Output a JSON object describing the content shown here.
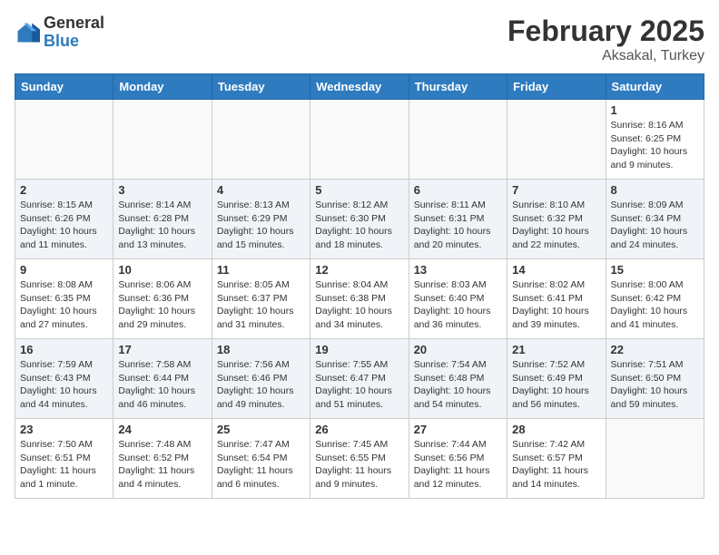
{
  "header": {
    "logo_general": "General",
    "logo_blue": "Blue",
    "month_year": "February 2025",
    "location": "Aksakal, Turkey"
  },
  "days_of_week": [
    "Sunday",
    "Monday",
    "Tuesday",
    "Wednesday",
    "Thursday",
    "Friday",
    "Saturday"
  ],
  "weeks": [
    [
      {
        "day": "",
        "detail": ""
      },
      {
        "day": "",
        "detail": ""
      },
      {
        "day": "",
        "detail": ""
      },
      {
        "day": "",
        "detail": ""
      },
      {
        "day": "",
        "detail": ""
      },
      {
        "day": "",
        "detail": ""
      },
      {
        "day": "1",
        "detail": "Sunrise: 8:16 AM\nSunset: 6:25 PM\nDaylight: 10 hours\nand 9 minutes."
      }
    ],
    [
      {
        "day": "2",
        "detail": "Sunrise: 8:15 AM\nSunset: 6:26 PM\nDaylight: 10 hours\nand 11 minutes."
      },
      {
        "day": "3",
        "detail": "Sunrise: 8:14 AM\nSunset: 6:28 PM\nDaylight: 10 hours\nand 13 minutes."
      },
      {
        "day": "4",
        "detail": "Sunrise: 8:13 AM\nSunset: 6:29 PM\nDaylight: 10 hours\nand 15 minutes."
      },
      {
        "day": "5",
        "detail": "Sunrise: 8:12 AM\nSunset: 6:30 PM\nDaylight: 10 hours\nand 18 minutes."
      },
      {
        "day": "6",
        "detail": "Sunrise: 8:11 AM\nSunset: 6:31 PM\nDaylight: 10 hours\nand 20 minutes."
      },
      {
        "day": "7",
        "detail": "Sunrise: 8:10 AM\nSunset: 6:32 PM\nDaylight: 10 hours\nand 22 minutes."
      },
      {
        "day": "8",
        "detail": "Sunrise: 8:09 AM\nSunset: 6:34 PM\nDaylight: 10 hours\nand 24 minutes."
      }
    ],
    [
      {
        "day": "9",
        "detail": "Sunrise: 8:08 AM\nSunset: 6:35 PM\nDaylight: 10 hours\nand 27 minutes."
      },
      {
        "day": "10",
        "detail": "Sunrise: 8:06 AM\nSunset: 6:36 PM\nDaylight: 10 hours\nand 29 minutes."
      },
      {
        "day": "11",
        "detail": "Sunrise: 8:05 AM\nSunset: 6:37 PM\nDaylight: 10 hours\nand 31 minutes."
      },
      {
        "day": "12",
        "detail": "Sunrise: 8:04 AM\nSunset: 6:38 PM\nDaylight: 10 hours\nand 34 minutes."
      },
      {
        "day": "13",
        "detail": "Sunrise: 8:03 AM\nSunset: 6:40 PM\nDaylight: 10 hours\nand 36 minutes."
      },
      {
        "day": "14",
        "detail": "Sunrise: 8:02 AM\nSunset: 6:41 PM\nDaylight: 10 hours\nand 39 minutes."
      },
      {
        "day": "15",
        "detail": "Sunrise: 8:00 AM\nSunset: 6:42 PM\nDaylight: 10 hours\nand 41 minutes."
      }
    ],
    [
      {
        "day": "16",
        "detail": "Sunrise: 7:59 AM\nSunset: 6:43 PM\nDaylight: 10 hours\nand 44 minutes."
      },
      {
        "day": "17",
        "detail": "Sunrise: 7:58 AM\nSunset: 6:44 PM\nDaylight: 10 hours\nand 46 minutes."
      },
      {
        "day": "18",
        "detail": "Sunrise: 7:56 AM\nSunset: 6:46 PM\nDaylight: 10 hours\nand 49 minutes."
      },
      {
        "day": "19",
        "detail": "Sunrise: 7:55 AM\nSunset: 6:47 PM\nDaylight: 10 hours\nand 51 minutes."
      },
      {
        "day": "20",
        "detail": "Sunrise: 7:54 AM\nSunset: 6:48 PM\nDaylight: 10 hours\nand 54 minutes."
      },
      {
        "day": "21",
        "detail": "Sunrise: 7:52 AM\nSunset: 6:49 PM\nDaylight: 10 hours\nand 56 minutes."
      },
      {
        "day": "22",
        "detail": "Sunrise: 7:51 AM\nSunset: 6:50 PM\nDaylight: 10 hours\nand 59 minutes."
      }
    ],
    [
      {
        "day": "23",
        "detail": "Sunrise: 7:50 AM\nSunset: 6:51 PM\nDaylight: 11 hours\nand 1 minute."
      },
      {
        "day": "24",
        "detail": "Sunrise: 7:48 AM\nSunset: 6:52 PM\nDaylight: 11 hours\nand 4 minutes."
      },
      {
        "day": "25",
        "detail": "Sunrise: 7:47 AM\nSunset: 6:54 PM\nDaylight: 11 hours\nand 6 minutes."
      },
      {
        "day": "26",
        "detail": "Sunrise: 7:45 AM\nSunset: 6:55 PM\nDaylight: 11 hours\nand 9 minutes."
      },
      {
        "day": "27",
        "detail": "Sunrise: 7:44 AM\nSunset: 6:56 PM\nDaylight: 11 hours\nand 12 minutes."
      },
      {
        "day": "28",
        "detail": "Sunrise: 7:42 AM\nSunset: 6:57 PM\nDaylight: 11 hours\nand 14 minutes."
      },
      {
        "day": "",
        "detail": ""
      }
    ]
  ]
}
